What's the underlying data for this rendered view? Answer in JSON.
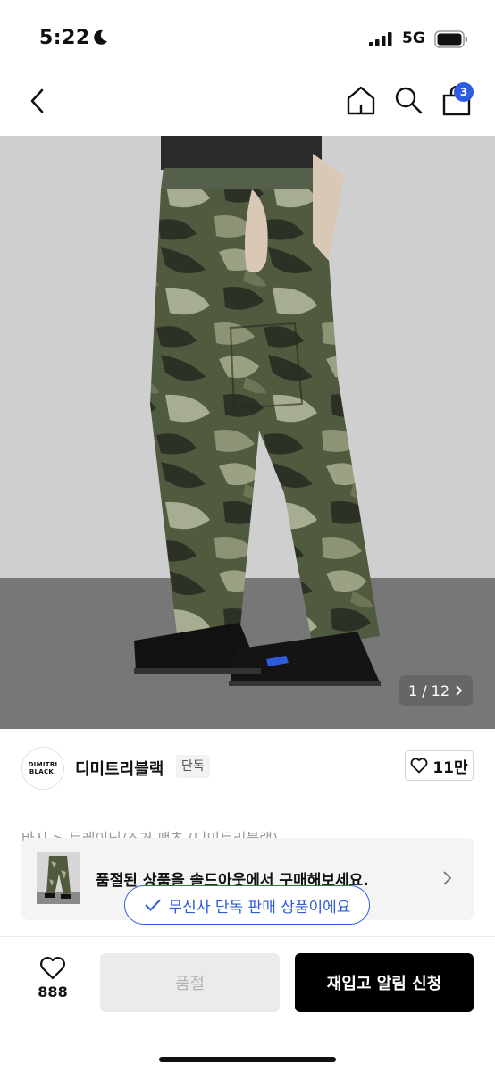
{
  "status_bar": {
    "time": "5:22",
    "network": "5G",
    "icons": [
      "moon-icon",
      "signal-icon",
      "battery-icon"
    ]
  },
  "nav": {
    "icons": [
      "back-chevron-icon",
      "home-icon",
      "search-icon",
      "shopping-bag-icon"
    ],
    "cart_badge": "3"
  },
  "gallery": {
    "counter": "1 / 12",
    "counter_icon": "chevron-right-icon"
  },
  "brand": {
    "logo_line1": "DIMITRI",
    "logo_line2": "BLACK.",
    "name": "디미트리블랙",
    "tag": "단독",
    "likes": "11만",
    "like_icon": "heart-outline-icon"
  },
  "breadcrumb": {
    "text": "바지 > 트레이닝/조거 팬츠 (디미트리블랙)"
  },
  "soldout_banner": {
    "text": "품절된 상품을 솔드아웃에서 구매해보세요."
  },
  "exclusive_notice": {
    "text": "무신사 단독 판매 상품이에요"
  },
  "bottom_bar": {
    "wish_count": "888",
    "soldout_label": "품절",
    "restock_label": "재입고 알림 신청"
  },
  "colors": {
    "accent_blue": "#2f5bdf",
    "primary_button": "#000000",
    "disabled_button": "#ebebeb"
  }
}
